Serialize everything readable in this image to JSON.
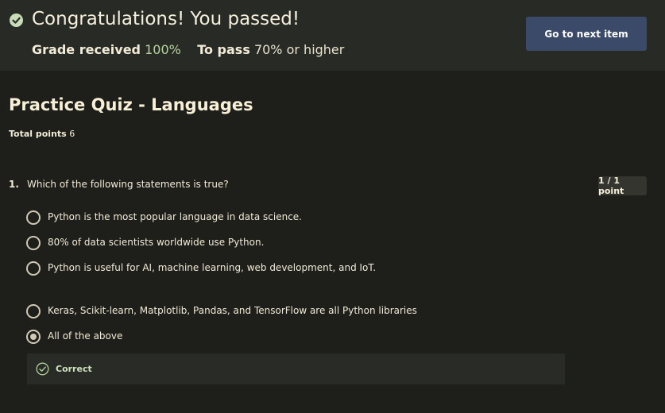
{
  "banner": {
    "title": "Congratulations! You passed!",
    "grade_label": "Grade received",
    "grade_value": "100%",
    "pass_label": "To pass",
    "pass_value": "70%",
    "pass_suffix": "or higher",
    "next_button": "Go to next item",
    "check_icon": "check-circle-icon"
  },
  "quiz": {
    "title": "Practice Quiz - Languages",
    "total_points_label": "Total points",
    "total_points_value": "6"
  },
  "question": {
    "number": "1.",
    "text": "Which of the following statements is true?",
    "score": "1 / 1 point",
    "options": [
      {
        "label": "Python is the most popular language in data science.",
        "selected": false
      },
      {
        "label": "80% of data scientists worldwide use Python.",
        "selected": false
      },
      {
        "label": "Python is useful for AI, machine learning, web development, and IoT.",
        "selected": false
      },
      {
        "label": "Keras, Scikit-learn, Matplotlib, Pandas, and TensorFlow are all Python libraries",
        "selected": false
      },
      {
        "label": "All of the above",
        "selected": true
      }
    ],
    "feedback": {
      "label": "Correct",
      "icon": "check-circle-outline-icon"
    }
  },
  "colors": {
    "background": "#1e1e1b",
    "banner": "#282a26",
    "button": "#3a4a68",
    "success_green": "#b6d39e"
  }
}
